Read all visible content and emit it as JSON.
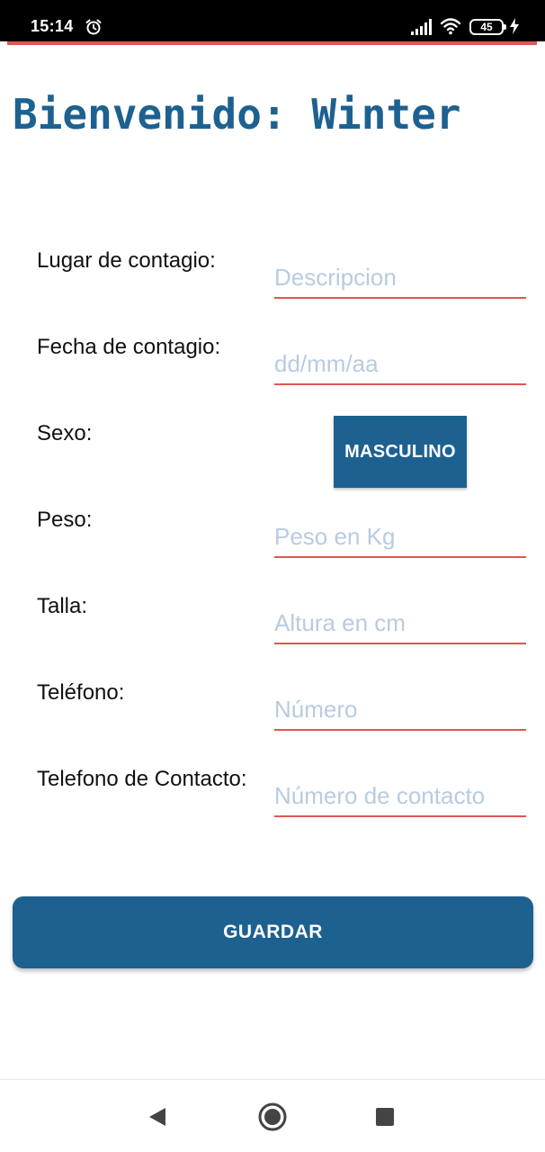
{
  "status_bar": {
    "time": "15:14",
    "battery_level": "45",
    "icons": [
      "alarm-icon",
      "signal-icon",
      "wifi-icon",
      "battery-icon",
      "charging-icon"
    ]
  },
  "colors": {
    "primary": "#1d6190",
    "accent": "#e05652",
    "placeholder": "#b9cbe0"
  },
  "header": {
    "title": "Bienvenido: Winter"
  },
  "form": {
    "lugar": {
      "label": "Lugar de contagio:",
      "placeholder": "Descripcion"
    },
    "fecha": {
      "label": "Fecha de contagio:",
      "placeholder": "dd/mm/aa"
    },
    "sexo": {
      "label": "Sexo:",
      "value": "MASCULINO"
    },
    "peso": {
      "label": "Peso:",
      "placeholder": "Peso en Kg"
    },
    "talla": {
      "label": "Talla:",
      "placeholder": "Altura en cm"
    },
    "telefono": {
      "label": "Teléfono:",
      "placeholder": "Número"
    },
    "telefono_contacto": {
      "label": "Telefono de Contacto:",
      "placeholder": "Número de contacto"
    }
  },
  "actions": {
    "save_label": "GUARDAR"
  },
  "nav_bar": {
    "icons": [
      "back-icon",
      "home-icon",
      "recents-icon"
    ]
  }
}
